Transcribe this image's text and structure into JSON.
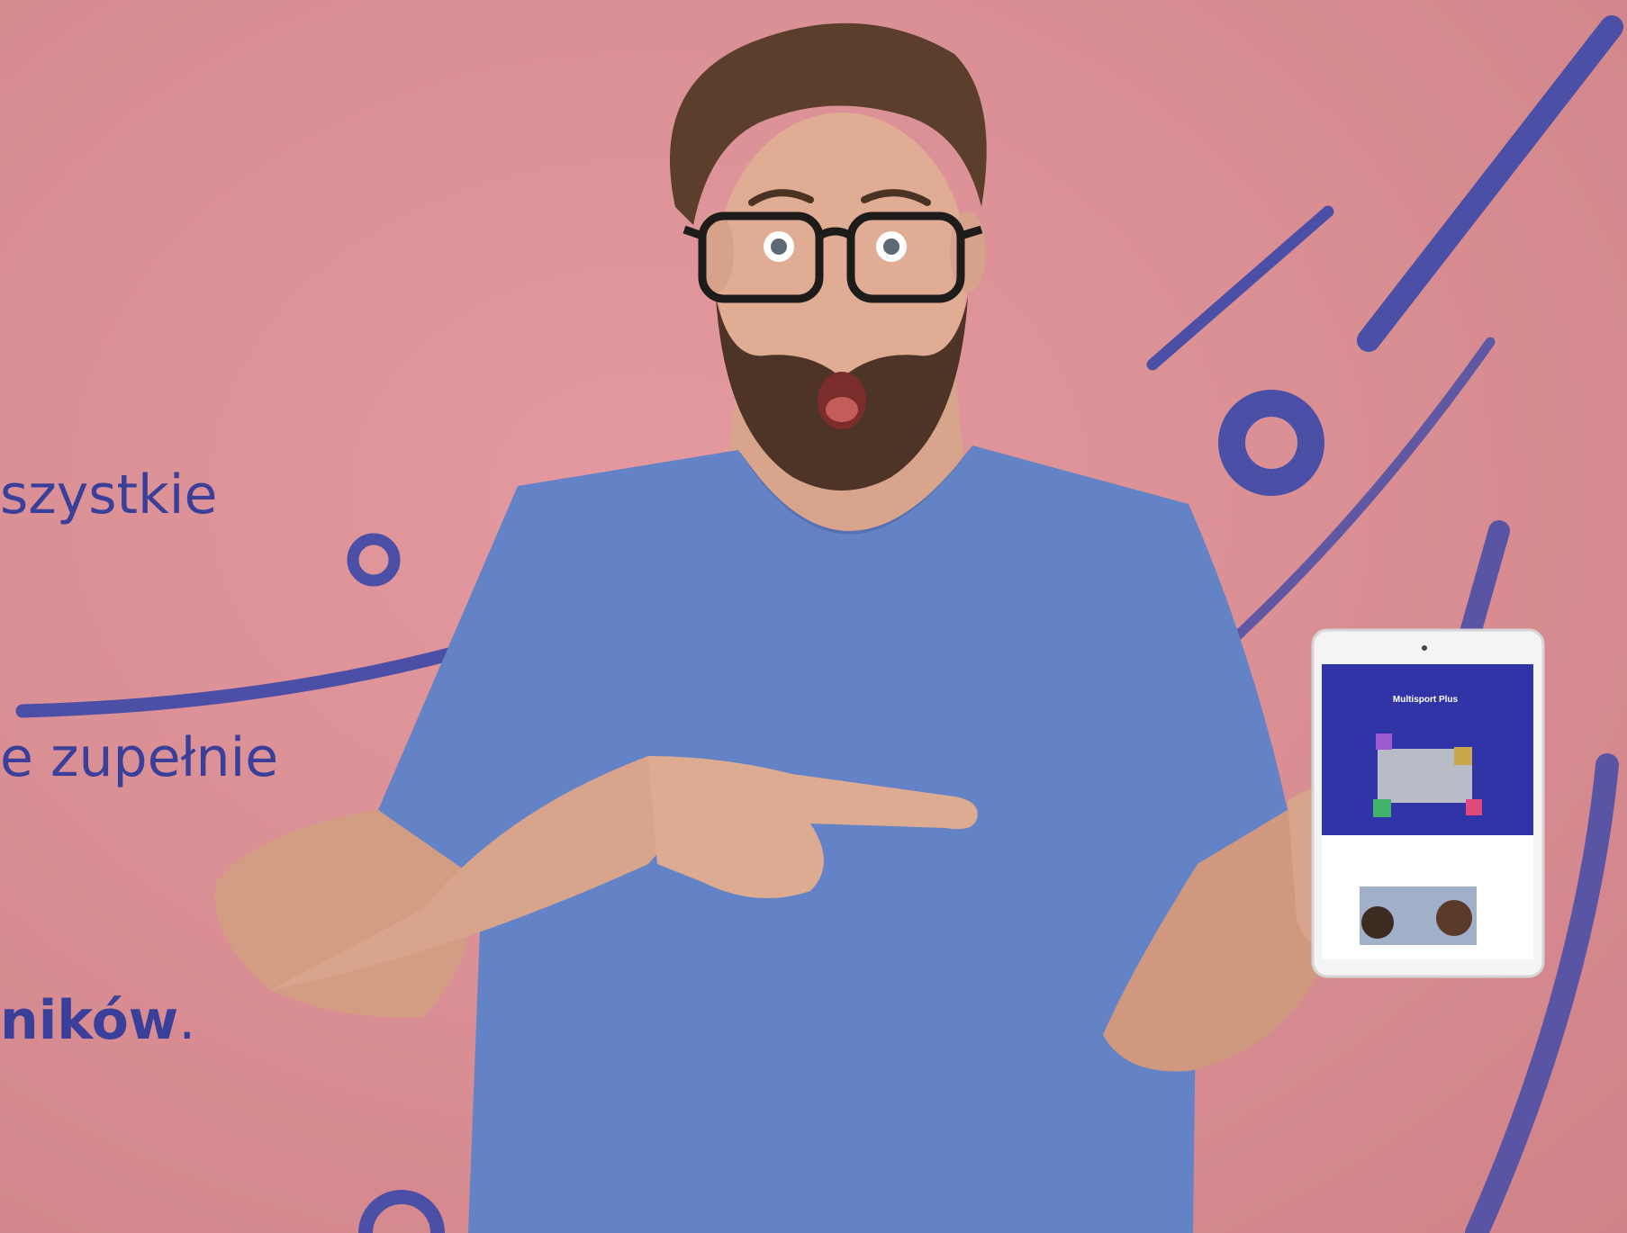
{
  "headline": {
    "line1": "szystkie",
    "line2": "e zupełnie",
    "line3_bold": "ników",
    "line3_suffix": "."
  },
  "tablet": {
    "screen_title": "Multisport Plus"
  },
  "colors": {
    "background": "#d98e93",
    "accent": "#3a3f9a",
    "shirt": "#5f7fc4"
  }
}
